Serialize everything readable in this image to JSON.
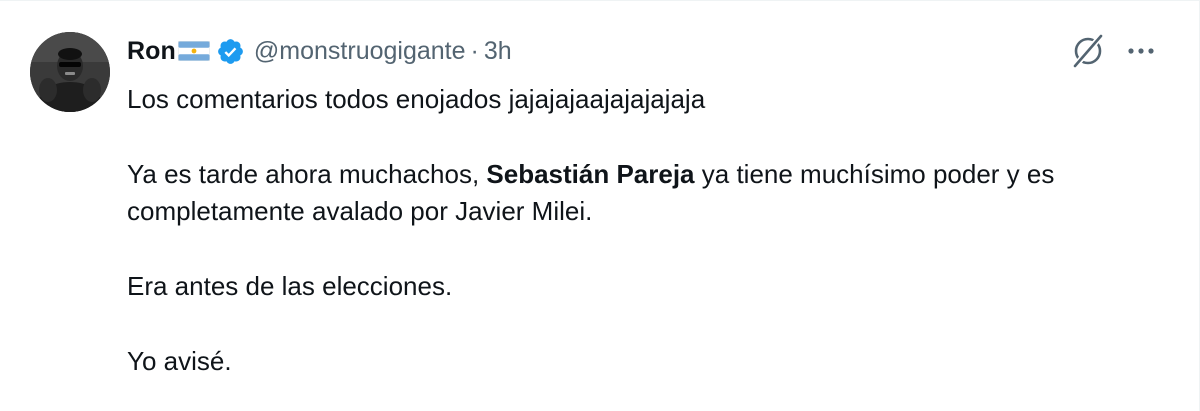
{
  "tweet": {
    "author": {
      "display_name": "Ron",
      "flag_icon": "argentina-flag-icon",
      "verified_icon": "verified-badge-icon",
      "verified_color": "#1d9bf0",
      "handle": "@monstruogigante",
      "separator": "·",
      "time": "3h"
    },
    "actions": {
      "grok_icon": "grok-icon",
      "more_icon": "more-horizontal-icon"
    },
    "body": {
      "line1": "Los comentarios todos enojados jajajajaajajajajaja",
      "para2_before": "Ya es tarde ahora muchachos, ",
      "para2_bold": "Sebastián Pareja",
      "para2_after": " ya tiene muchísimo poder y es completamente avalado por Javier Milei.",
      "para3": "Era antes de las elecciones.",
      "para4": "Yo avisé."
    },
    "colors": {
      "text": "#0f1419",
      "secondary": "#536471",
      "accent": "#1d9bf0"
    }
  }
}
